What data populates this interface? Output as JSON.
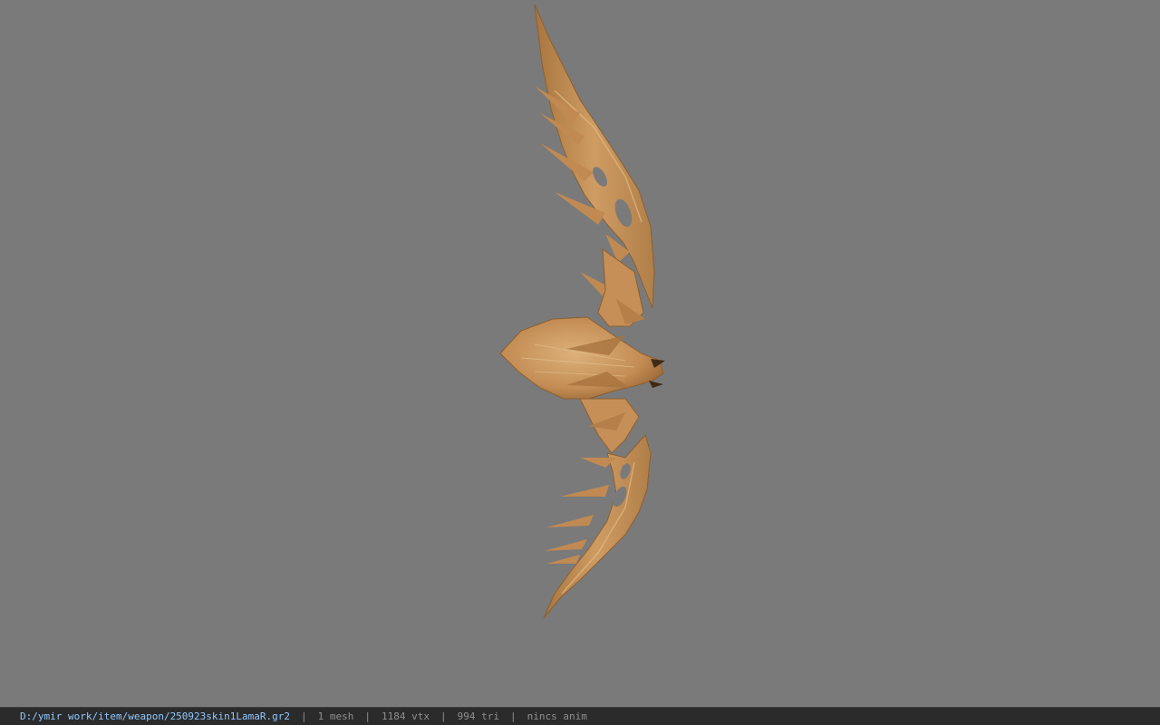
{
  "statusbar": {
    "file_path": "D:/ymir work/item/weapon/250923skin1LamaR.gr2",
    "separator": "|",
    "mesh_count": "1 mesh",
    "vertex_count": "1184 vtx",
    "triangle_count": "994 tri",
    "anim_status": "nincs anim"
  },
  "viewport": {
    "background_color": "#7a7a7a",
    "model_color": "#c9965e",
    "model_shadow_color": "#9c6d3f",
    "model_highlight_color": "#e2bb85"
  }
}
